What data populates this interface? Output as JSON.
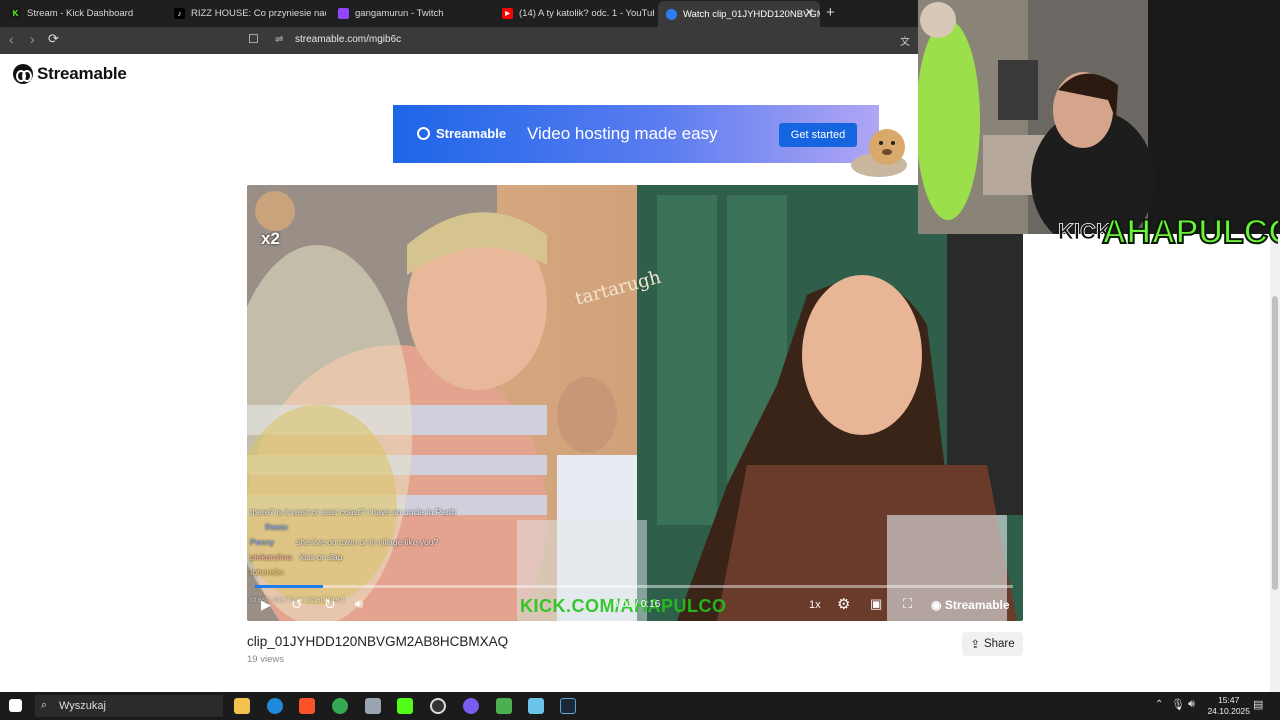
{
  "browser": {
    "tabs": [
      {
        "label": "Stream - Kick Dashboard",
        "icon": "kick-icon",
        "color": "#53fc18"
      },
      {
        "label": "RIZZ HOUSE: Co przyniesie nadchod",
        "icon": "tiktok-icon",
        "color": "#111111"
      },
      {
        "label": "gangamurun - Twitch",
        "icon": "twitch-icon",
        "color": "#9146ff"
      },
      {
        "label": "(14) A ty katolik? odc. 1 - YouTube",
        "icon": "youtube-icon",
        "color": "#ff0000"
      },
      {
        "label": "Watch clip_01JYHDD120NBVGM",
        "icon": "streamable-icon",
        "color": "#2d7cf6",
        "active": true
      }
    ],
    "new_tab": "+",
    "url": "streamable.com/mgib6c"
  },
  "page": {
    "logo_text": "Streamable",
    "banner": {
      "brand": "Streamable",
      "headline": "Video hosting made easy",
      "cta": "Get started"
    },
    "video": {
      "chat_lines": [
        {
          "user": "",
          "text": "there? is it west or east coast? i have an uncle in Perth"
        },
        {
          "user": "Reeto",
          "text": ""
        },
        {
          "user": "Penny",
          "text": "she live on town or in village like you?"
        },
        {
          "user": "piekarolina:",
          "text": "kiss or slap"
        },
        {
          "user": "toberelle:",
          "text": ""
        },
        {
          "user": "",
          "text": "crash me in ur apartment"
        }
      ],
      "time": "0:01 / 0:16",
      "progress": 0.09,
      "speed": "1x",
      "watermark": "KICK.COM/AHAPULCO",
      "brand": "Streamable",
      "badge": "x2"
    },
    "clip_title": "clip_01JYHDD120NBVGM2AB8HCBMXAQ",
    "views": "19 views",
    "share_label": "Share"
  },
  "overlay": {
    "kick_text": "KICK",
    "channel": "AHAPULCO"
  },
  "taskbar": {
    "search_placeholder": "Wyszukaj",
    "time": "15:47",
    "date": "24.10.2025"
  }
}
